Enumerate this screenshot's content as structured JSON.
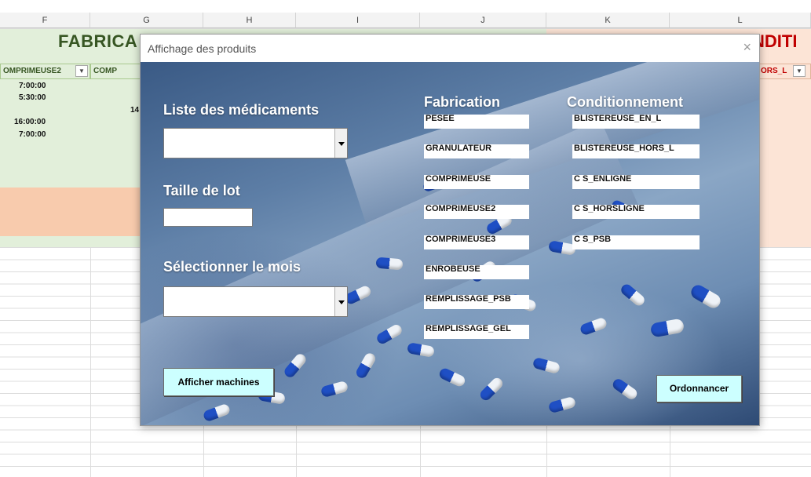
{
  "spreadsheet": {
    "columns": [
      "F",
      "G",
      "H",
      "I",
      "J",
      "K",
      "L"
    ],
    "fabrication_title": "FABRICA",
    "conditionnement_title": "NDITI",
    "filter_headers": [
      "OMPRIMEUSE2",
      "COMP",
      "ORS_L"
    ],
    "times_col_f": [
      "7:00:00",
      "5:30:00",
      "",
      "16:00:00",
      "7:00:00"
    ],
    "col_g_value": "14"
  },
  "dialog": {
    "title": "Affichage des produits",
    "close": "×",
    "labels": {
      "medicaments": "Liste des médicaments",
      "taille": "Taille de lot",
      "mois": "Sélectionner le mois",
      "fabrication": "Fabrication",
      "conditionnement": "Conditionnement"
    },
    "inputs": {
      "medicaments_value": "",
      "taille_value": "",
      "mois_value": ""
    },
    "fabrication_machines": [
      "PESEE",
      "GRANULATEUR",
      "COMPRIMEUSE",
      "COMPRIMEUSE2",
      "COMPRIMEUSE3",
      "ENROBEUSE",
      "REMPLISSAGE_PSB",
      "REMPLISSAGE_GEL"
    ],
    "conditionnement_machines": [
      "BLISTEREUSE_EN_L",
      "BLISTEREUSE_HORS_L",
      "C S_ENLIGNE",
      "C S_HORSLIGNE",
      "C S_PSB"
    ],
    "buttons": {
      "afficher": "Afficher machines",
      "ordonnancer": "Ordonnancer"
    },
    "colors": {
      "button_bg": "#ccffff",
      "label_text": "#ffffff",
      "fab_title": "#375623",
      "cond_title": "#c00000"
    }
  }
}
